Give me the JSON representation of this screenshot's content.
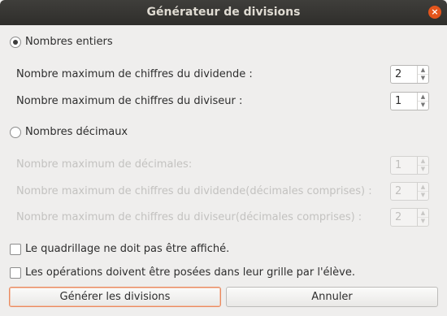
{
  "window": {
    "title": "Générateur de divisions",
    "close_glyph": "×"
  },
  "integers": {
    "radio_label": "Nombres entiers",
    "selected": true,
    "dividend_label": "Nombre maximum de chiffres du dividende :",
    "dividend_value": "2",
    "divisor_label": "Nombre maximum de chiffres du diviseur :",
    "divisor_value": "1"
  },
  "decimals": {
    "radio_label": "Nombres décimaux",
    "selected": false,
    "decimals_label": "Nombre maximum de décimales:",
    "decimals_value": "1",
    "dividend_label": "Nombre maximum de chiffres du dividende(décimales comprises) :",
    "dividend_value": "2",
    "divisor_label": "Nombre maximum de chiffres du diviseur(décimales comprises) :",
    "divisor_value": "2"
  },
  "options": {
    "hide_grid_label": "Le quadrillage ne doit pas être affiché.",
    "hide_grid_checked": false,
    "student_grid_label": "Les opérations doivent être posées dans leur grille par l'élève.",
    "student_grid_checked": false
  },
  "buttons": {
    "generate": "Générer les divisions",
    "cancel": "Annuler"
  },
  "icons": {
    "spin_up": "▲",
    "spin_down": "▼"
  },
  "colors": {
    "titlebar": "#3a3936",
    "close": "#e4551c",
    "focus": "#e98a5f"
  }
}
